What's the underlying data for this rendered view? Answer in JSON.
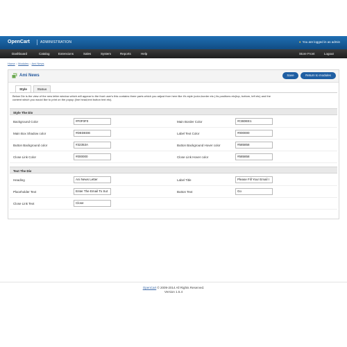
{
  "header": {
    "brand": "OpenCart",
    "subtitle": "ADMINISTRATION",
    "logged_in": "You are logged in as admin"
  },
  "menu": {
    "left": [
      "Dashboard",
      "Catalog",
      "Extensions",
      "Sales",
      "System",
      "Reports",
      "Help"
    ],
    "store_front": "Store Front",
    "logout": "Logout"
  },
  "breadcrumb": {
    "home": "Home",
    "sep1": " :: ",
    "modules": "Modules",
    "sep2": " :: ",
    "current": "Ami News"
  },
  "page": {
    "title": "Ami News",
    "save": "Save",
    "return": "Return to modules",
    "tabs": [
      "Style",
      "Status"
    ],
    "description": "Below Div is the view of the new letter window which will appear to the front user's this contains three parts which you adjust from here like it's style (color,border etc.) its positions etc(top, bottom, left etc) and the content which you would like to print on the popup (line head,text button text etc)."
  },
  "style_section": {
    "heading": "Style The Div",
    "rows": [
      {
        "l1": "Background Color",
        "v1": "#F0F0F0",
        "l2": "Main Border Color",
        "v2": "#CBDEE1"
      },
      {
        "l1": "Main Box Shadow color",
        "v1": "#DEDEDE",
        "l2": "Label Text Color",
        "v2": "#000000"
      },
      {
        "l1": "Button Background color",
        "v1": "#32353A",
        "l2": "Button Background Hover color",
        "v2": "#585858"
      },
      {
        "l1": "Close Link Color",
        "v1": "#000000",
        "l2": "Close Link Hover color",
        "v2": "#585858"
      }
    ]
  },
  "text_section": {
    "heading": "Text The Div",
    "rows": [
      {
        "l1": "Heading",
        "v1": "Ani News Letter",
        "l2": "Label Title",
        "v2": "Please Fill Your Email I"
      },
      {
        "l1": "Placeholder Text",
        "v1": "Enter The Email To Sut",
        "l2": "Button Text",
        "v2": "Go"
      }
    ],
    "close_label": "Close Link Text",
    "close_value": "Close"
  },
  "footer": {
    "brand": "OpenCart",
    "copyright": " © 2009-2014 All Rights Reserved.",
    "version": "Version 1.5.4"
  },
  "colors": {
    "header": "#1a5e9e",
    "menu": "#2b2b2b",
    "accent": "#1f5fa3"
  }
}
